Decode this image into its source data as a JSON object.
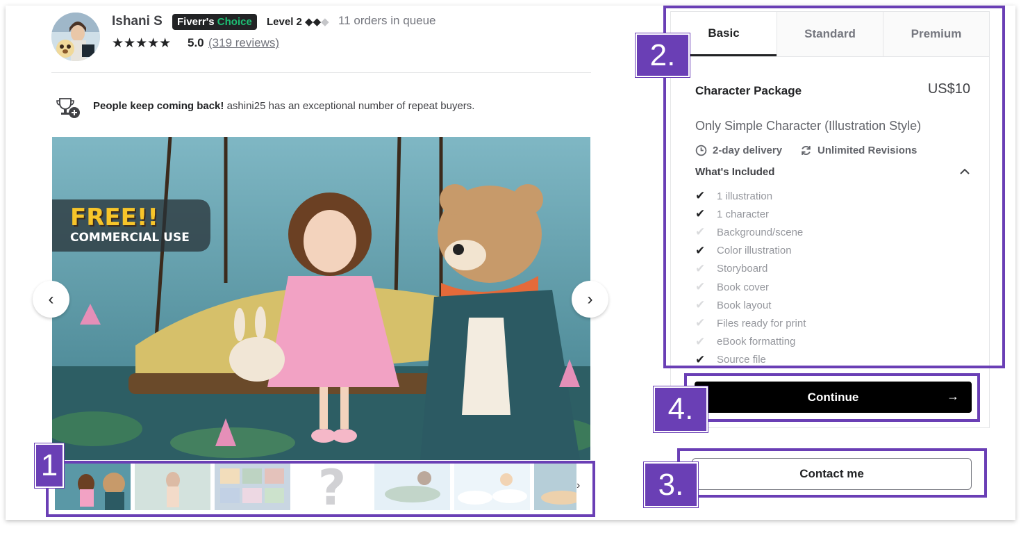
{
  "seller": {
    "name": "Ishani S",
    "badge_prefix": "Fiverr's",
    "badge_accent": "Choice",
    "level": "Level 2",
    "level_diamonds_on": "◆◆",
    "level_diamonds_off": "◆",
    "queue": "11 orders in queue",
    "stars": "★★★★★",
    "rating": "5.0",
    "reviews": "(319 reviews)"
  },
  "repeat_buyers": {
    "bold": "People keep coming back!",
    "text": " ashini25 has an exceptional number of repeat buyers."
  },
  "gallery": {
    "badge_line1": "FREE!!",
    "badge_line2": "COMMERCIAL USE",
    "prev_icon": "‹",
    "next_icon": "›",
    "thumbs_next_icon": "›"
  },
  "package": {
    "tabs": [
      "Basic",
      "Standard",
      "Premium"
    ],
    "title": "Character Package",
    "price": "US$10",
    "description": "Only Simple Character (Illustration Style)",
    "delivery": "2-day delivery",
    "revisions": "Unlimited Revisions",
    "included_heading": "What's Included",
    "features": [
      {
        "label": "1 illustration",
        "included": true
      },
      {
        "label": "1 character",
        "included": true
      },
      {
        "label": "Background/scene",
        "included": false
      },
      {
        "label": "Color illustration",
        "included": true
      },
      {
        "label": "Storyboard",
        "included": false
      },
      {
        "label": "Book cover",
        "included": false
      },
      {
        "label": "Book layout",
        "included": false
      },
      {
        "label": "Files ready for print",
        "included": false
      },
      {
        "label": "eBook formatting",
        "included": false
      },
      {
        "label": "Source file",
        "included": true
      }
    ],
    "continue_label": "Continue",
    "continue_arrow": "→",
    "contact_label": "Contact me"
  },
  "annotations": {
    "label_1": "1",
    "label_2": "2.",
    "label_3": "3.",
    "label_4": "4.",
    "color": "#6a3fb5"
  },
  "colors": {
    "accent_green": "#1dbf73",
    "button_black": "#000000",
    "annotation_purple": "#6a3fb5"
  }
}
